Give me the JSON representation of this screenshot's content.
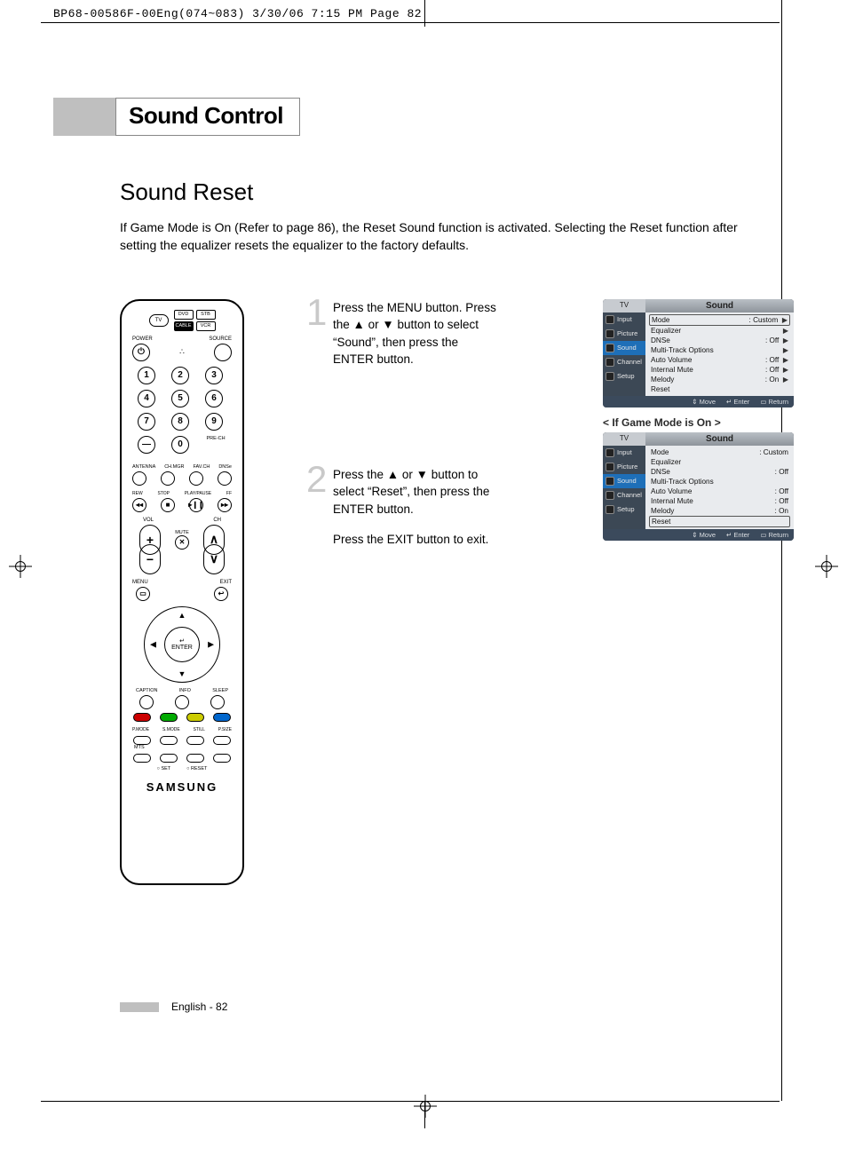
{
  "meta": {
    "header": "BP68-00586F-00Eng(074~083)  3/30/06  7:15 PM  Page 82"
  },
  "title": "Sound Control",
  "subtitle": "Sound Reset",
  "intro": "If Game Mode is On (Refer to page 86), the Reset Sound function is activated. Selecting the Reset function after setting the equalizer resets the equalizer to the factory defaults.",
  "steps": {
    "s1": {
      "num": "1",
      "text": "Press the MENU button. Press the ▲ or ▼ button to select “Sound”, then press the ENTER button."
    },
    "s2": {
      "num": "2",
      "text": "Press the ▲ or ▼ button to select “Reset”, then press the ENTER button.",
      "text2": "Press the EXIT button to exit."
    }
  },
  "osd_caption": "< If Game Mode is On >",
  "osd": {
    "tabs": {
      "left": "TV",
      "title": "Sound"
    },
    "side": [
      "Input",
      "Picture",
      "Sound",
      "Channel",
      "Setup"
    ],
    "rows": [
      {
        "label": "Mode",
        "value": ": Custom",
        "arrow": true
      },
      {
        "label": "Equalizer",
        "value": "",
        "arrow": true
      },
      {
        "label": "DNSe",
        "value": ": Off",
        "arrow": true
      },
      {
        "label": "Multi-Track Options",
        "value": "",
        "arrow": true
      },
      {
        "label": "Auto Volume",
        "value": ": Off",
        "arrow": true
      },
      {
        "label": "Internal Mute",
        "value": ": Off",
        "arrow": true
      },
      {
        "label": "Melody",
        "value": ": On",
        "arrow": true
      },
      {
        "label": "Reset",
        "value": "",
        "arrow": false
      }
    ],
    "foot": {
      "move": "Move",
      "enter": "Enter",
      "ret": "Return"
    }
  },
  "osd2": {
    "rows": [
      {
        "label": "Mode",
        "value": ": Custom",
        "arrow": false
      },
      {
        "label": "Equalizer",
        "value": "",
        "arrow": false
      },
      {
        "label": "DNSe",
        "value": ": Off",
        "arrow": false
      },
      {
        "label": "Multi-Track Options",
        "value": "",
        "arrow": false
      },
      {
        "label": "Auto Volume",
        "value": ": Off",
        "arrow": false
      },
      {
        "label": "Internal Mute",
        "value": ": Off",
        "arrow": false
      },
      {
        "label": "Melody",
        "value": ": On",
        "arrow": false
      },
      {
        "label": "Reset",
        "value": "",
        "arrow": false,
        "boxed": true
      }
    ]
  },
  "remote": {
    "src1": [
      "TV",
      "DVD",
      "STB"
    ],
    "src2": [
      "CABLE",
      "VCR"
    ],
    "lbl_power": "POWER",
    "lbl_source": "SOURCE",
    "nums": [
      "1",
      "2",
      "3",
      "4",
      "5",
      "6",
      "7",
      "8",
      "9",
      "0"
    ],
    "dash": "—",
    "prech": "PRE-CH",
    "row_lbls": [
      "ANTENNA",
      "CH.MGR",
      "FAV.CH",
      "DNSe"
    ],
    "trans_lbls": [
      "REW",
      "STOP",
      "PLAY/PAUSE",
      "FF"
    ],
    "trans": [
      "◂◂",
      "■",
      "▸❙❙",
      "▸▸"
    ],
    "vol": "VOL",
    "ch": "CH",
    "mute": "MUTE",
    "menu": "MENU",
    "exit": "EXIT",
    "enter": "ENTER",
    "row3": [
      "CAPTION",
      "INFO",
      "SLEEP"
    ],
    "row4": [
      "P.MODE",
      "S.MODE",
      "STILL",
      "P.SIZE"
    ],
    "mts": "MTS",
    "set": "SET",
    "reset": "RESET",
    "brand": "SAMSUNG"
  },
  "footer": {
    "lang": "English - 82"
  }
}
